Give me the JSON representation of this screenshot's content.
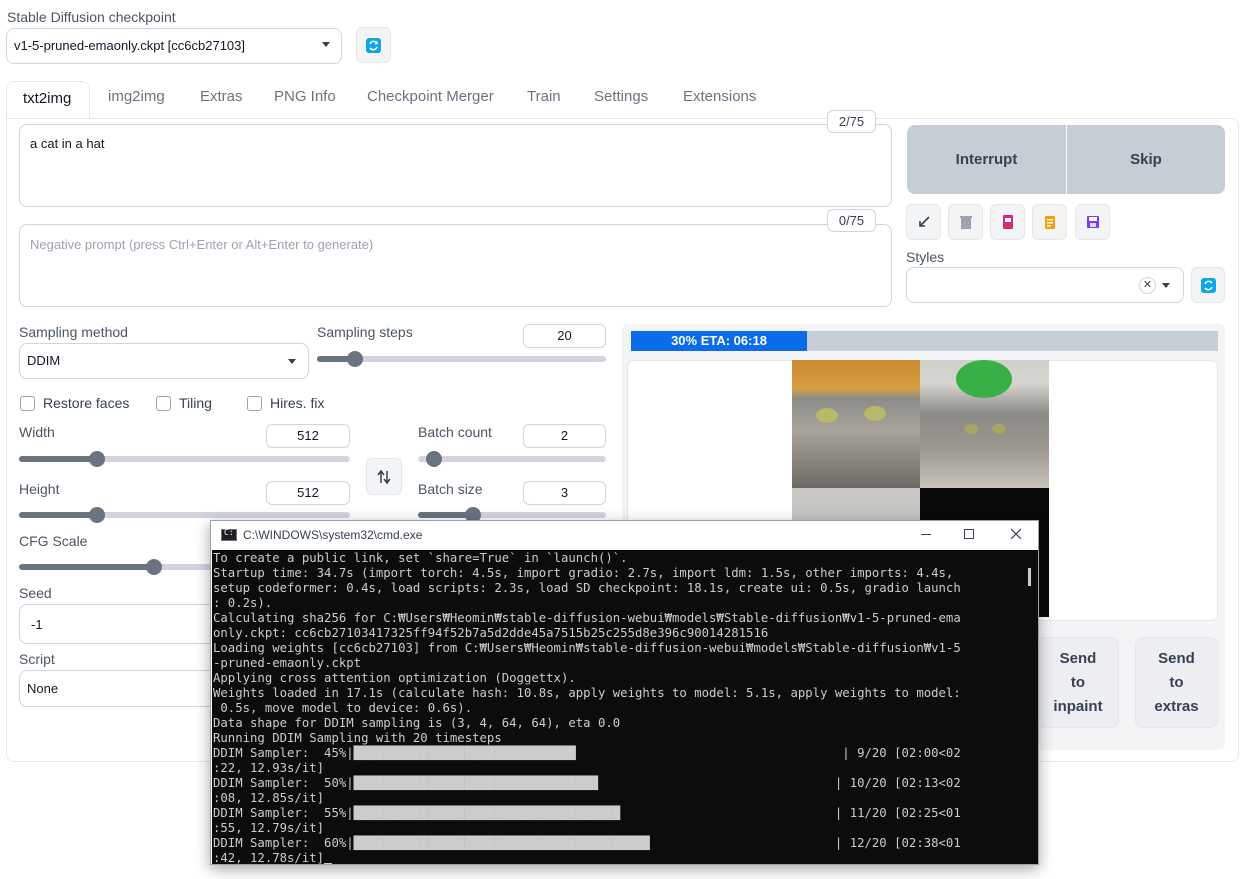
{
  "checkpoint": {
    "label": "Stable Diffusion checkpoint",
    "value": "v1-5-pruned-emaonly.ckpt [cc6cb27103]",
    "refresh_icon": "refresh-icon"
  },
  "tabs": [
    {
      "label": "txt2img",
      "active": true
    },
    {
      "label": "img2img"
    },
    {
      "label": "Extras"
    },
    {
      "label": "PNG Info"
    },
    {
      "label": "Checkpoint Merger"
    },
    {
      "label": "Train"
    },
    {
      "label": "Settings"
    },
    {
      "label": "Extensions"
    }
  ],
  "prompt": {
    "value": "a cat in a hat",
    "token_count": "2/75"
  },
  "negative_prompt": {
    "placeholder": "Negative prompt (press Ctrl+Enter or Alt+Enter to generate)",
    "token_count": "0/75"
  },
  "actions": {
    "interrupt": "Interrupt",
    "skip": "Skip"
  },
  "tool_icons": [
    "arrow-diagonal-icon",
    "trash-icon",
    "card-icon",
    "clipboard-icon",
    "save-icon"
  ],
  "styles": {
    "label": "Styles",
    "clear_glyph": "✕"
  },
  "sampling": {
    "method_label": "Sampling method",
    "method_value": "DDIM",
    "steps_label": "Sampling steps",
    "steps_value": "20",
    "steps_fraction": 0.13
  },
  "options": {
    "restore_faces": "Restore faces",
    "tiling": "Tiling",
    "hires_fix": "Hires. fix"
  },
  "dims": {
    "width_label": "Width",
    "width_value": "512",
    "width_fraction": 0.235,
    "height_label": "Height",
    "height_value": "512",
    "height_fraction": 0.235,
    "swap_icon": "swap-vertical-icon"
  },
  "batch": {
    "count_label": "Batch count",
    "count_value": "2",
    "count_fraction": 0.0,
    "size_label": "Batch size",
    "size_value": "3",
    "size_fraction": 0.29
  },
  "cfg": {
    "label": "CFG Scale",
    "fraction": 0.23
  },
  "seed": {
    "label": "Seed",
    "value": "-1"
  },
  "script": {
    "label": "Script",
    "value": "None"
  },
  "progress": {
    "text": "30% ETA: 06:18",
    "fraction": 0.3,
    "color": "#0b6be8"
  },
  "send": {
    "inpaint": [
      "Send",
      "to",
      "inpaint"
    ],
    "extras": [
      "Send",
      "to",
      "extras"
    ]
  },
  "terminal": {
    "title": "C:\\WINDOWS\\system32\\cmd.exe",
    "controls": [
      "minimize-icon",
      "maximize-icon",
      "close-icon"
    ],
    "lines": [
      "To create a public link, set `share=True` in `launch()`.",
      "Startup time: 34.7s (import torch: 4.5s, import gradio: 2.7s, import ldm: 1.5s, other imports: 4.4s,",
      "setup codeformer: 0.4s, load scripts: 2.3s, load SD checkpoint: 18.1s, create ui: 0.5s, gradio launch",
      ": 0.2s).",
      "Calculating sha256 for C:₩Users₩Heomin₩stable-diffusion-webui₩models₩Stable-diffusion₩v1-5-pruned-ema",
      "only.ckpt: cc6cb27103417325ff94f52b7a5d2dde45a7515b25c255d8e396c90014281516",
      "Loading weights [cc6cb27103] from C:₩Users₩Heomin₩stable-diffusion-webui₩models₩Stable-diffusion₩v1-5",
      "-pruned-emaonly.ckpt",
      "Applying cross attention optimization (Doggettx).",
      "Weights loaded in 17.1s (calculate hash: 10.8s, apply weights to model: 5.1s, apply weights to model:",
      " 0.5s, move model to device: 0.6s).",
      "Data shape for DDIM sampling is (3, 4, 64, 64), eta 0.0",
      "Running DDIM Sampling with 20 timesteps",
      "DDIM Sampler:  45%|██████████████████████████████                                    | 9/20 [02:00<02",
      ":22, 12.93s/it]",
      "DDIM Sampler:  50%|█████████████████████████████████                                | 10/20 [02:13<02",
      ":08, 12.85s/it]",
      "DDIM Sampler:  55%|████████████████████████████████████                             | 11/20 [02:25<01",
      ":55, 12.79s/it]",
      "DDIM Sampler:  60%|████████████████████████████████████████                         | 12/20 [02:38<01",
      ":42, 12.78s/it]"
    ]
  }
}
